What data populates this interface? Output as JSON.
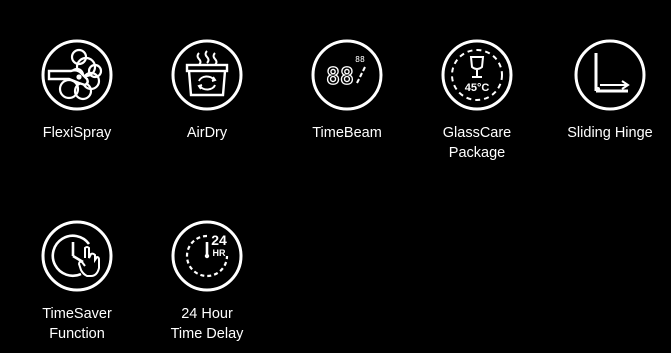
{
  "colors": {
    "background": "#000000",
    "foreground": "#ffffff"
  },
  "features": [
    {
      "icon": "flexispray-icon",
      "label_lines": [
        "FlexiSpray"
      ]
    },
    {
      "icon": "airdry-icon",
      "label_lines": [
        "AirDry"
      ]
    },
    {
      "icon": "timebeam-icon",
      "label_lines": [
        "TimeBeam"
      ],
      "icon_text": "88",
      "icon_small_text": "88"
    },
    {
      "icon": "glasscare-icon",
      "label_lines": [
        "GlassCare",
        "Package"
      ],
      "icon_text": "45°C"
    },
    {
      "icon": "sliding-hinge-icon",
      "label_lines": [
        "Sliding Hinge"
      ]
    },
    {
      "icon": "timesaver-icon",
      "label_lines": [
        "TimeSaver",
        "Function"
      ]
    },
    {
      "icon": "time-delay-24h-icon",
      "label_lines": [
        "24 Hour",
        "Time Delay"
      ],
      "icon_text": "24",
      "icon_small_text": "HR"
    }
  ]
}
